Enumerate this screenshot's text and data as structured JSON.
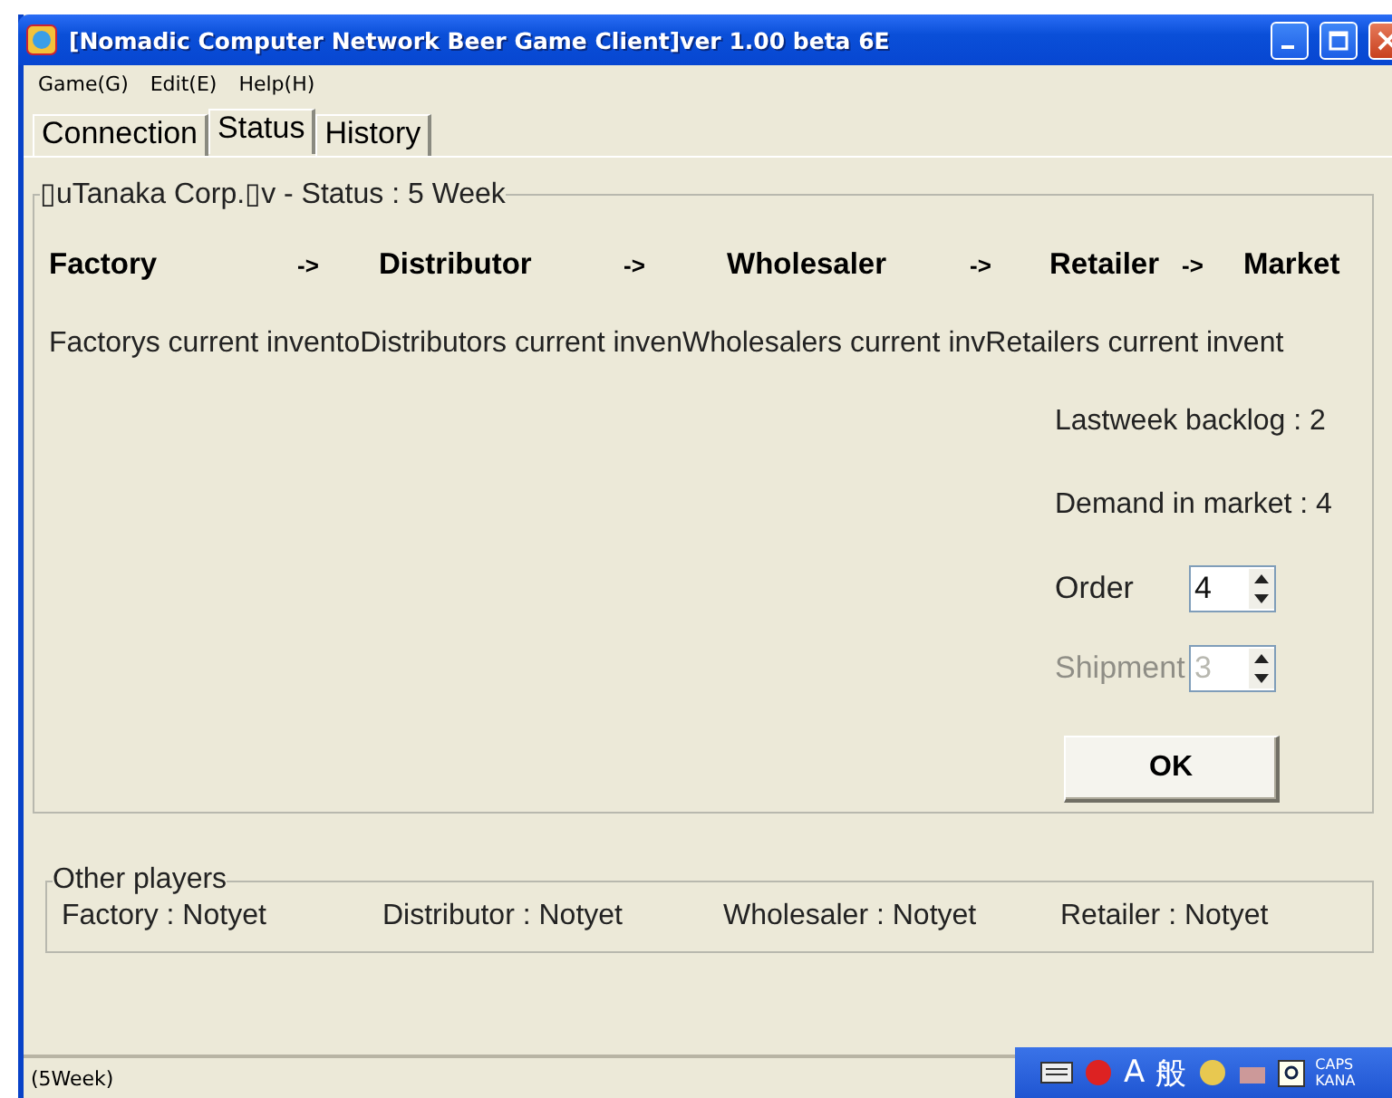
{
  "window": {
    "title": "[Nomadic Computer Network Beer Game Client]ver 1.00 beta 6E"
  },
  "menu": [
    "Game(G)",
    "Edit(E)",
    "Help(H)"
  ],
  "tabs": [
    {
      "label": "Connection",
      "selected": false
    },
    {
      "label": "Status",
      "selected": true
    },
    {
      "label": "History",
      "selected": false
    }
  ],
  "status_group": {
    "title": "▯uTanaka Corp.▯v - Status : 5 Week",
    "chain": [
      {
        "kind": "node",
        "label": "Factory"
      },
      {
        "kind": "arrow",
        "label": "->"
      },
      {
        "kind": "node",
        "label": "Distributor"
      },
      {
        "kind": "arrow",
        "label": "->"
      },
      {
        "kind": "node",
        "label": "Wholesaler"
      },
      {
        "kind": "arrow",
        "label": "->"
      },
      {
        "kind": "node",
        "label": "Retailer"
      },
      {
        "kind": "arrow",
        "label": "->"
      },
      {
        "kind": "node",
        "label": "Market"
      }
    ],
    "inventories": [
      "Factorys current invento",
      "Distributors current inven",
      "Wholesalers current inv",
      "Retailers current invent"
    ],
    "backlog": "Lastweek backlog : 2",
    "demand": "Demand in market : 4",
    "spinners": [
      {
        "label": "Order",
        "value": "4",
        "disabled": false
      },
      {
        "label": "Shipment",
        "value": "3",
        "disabled": true
      }
    ],
    "ok_button": "OK"
  },
  "other_players": {
    "title": "Other players",
    "players": [
      "Factory : Notyet",
      "Distributor : Notyet",
      "Wholesaler : Notyet",
      "Retailer : Notyet"
    ]
  },
  "status_bar": "(5Week)",
  "ime_bar": {
    "mode": "A",
    "conversion": "般",
    "caps": "CAPS",
    "kana": "KANA"
  }
}
